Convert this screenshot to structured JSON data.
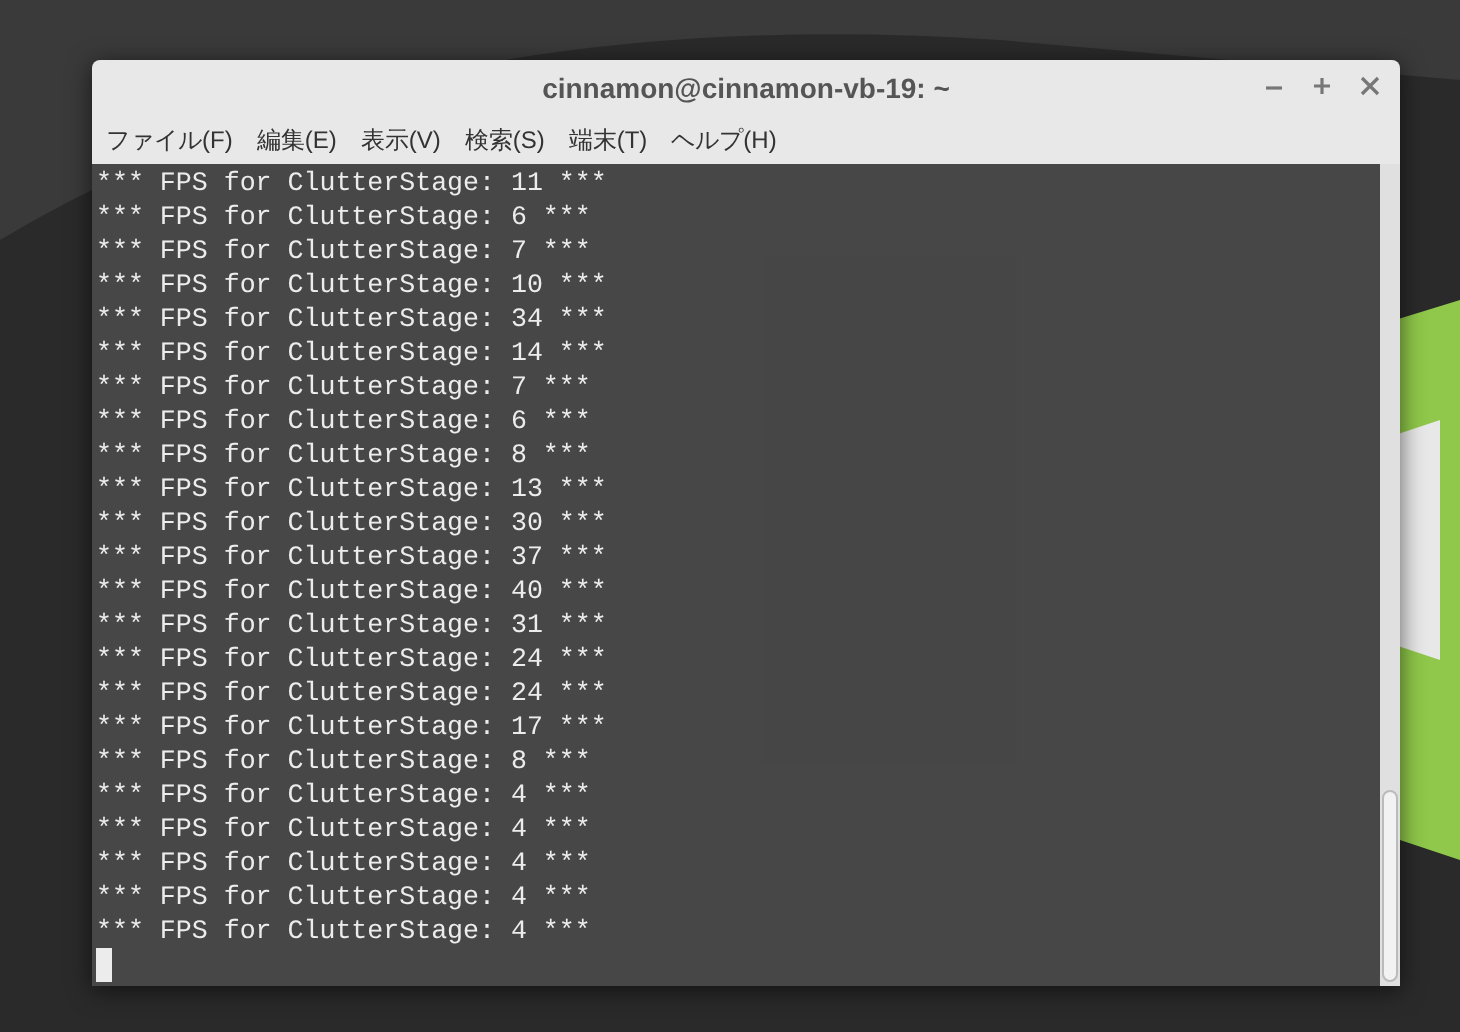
{
  "window": {
    "title": "cinnamon@cinnamon-vb-19: ~"
  },
  "menu": [
    "ファイル(F)",
    "編集(E)",
    "表示(V)",
    "検索(S)",
    "端末(T)",
    "ヘルプ(H)"
  ],
  "terminal": {
    "lines": [
      "*** FPS for ClutterStage: 11 ***",
      "*** FPS for ClutterStage: 6 ***",
      "*** FPS for ClutterStage: 7 ***",
      "*** FPS for ClutterStage: 10 ***",
      "*** FPS for ClutterStage: 34 ***",
      "*** FPS for ClutterStage: 14 ***",
      "*** FPS for ClutterStage: 7 ***",
      "*** FPS for ClutterStage: 6 ***",
      "*** FPS for ClutterStage: 8 ***",
      "*** FPS for ClutterStage: 13 ***",
      "*** FPS for ClutterStage: 30 ***",
      "*** FPS for ClutterStage: 37 ***",
      "*** FPS for ClutterStage: 40 ***",
      "*** FPS for ClutterStage: 31 ***",
      "*** FPS for ClutterStage: 24 ***",
      "*** FPS for ClutterStage: 24 ***",
      "*** FPS for ClutterStage: 17 ***",
      "*** FPS for ClutterStage: 8 ***",
      "*** FPS for ClutterStage: 4 ***",
      "*** FPS for ClutterStage: 4 ***",
      "*** FPS for ClutterStage: 4 ***",
      "*** FPS for ClutterStage: 4 ***",
      "*** FPS for ClutterStage: 4 ***"
    ]
  }
}
